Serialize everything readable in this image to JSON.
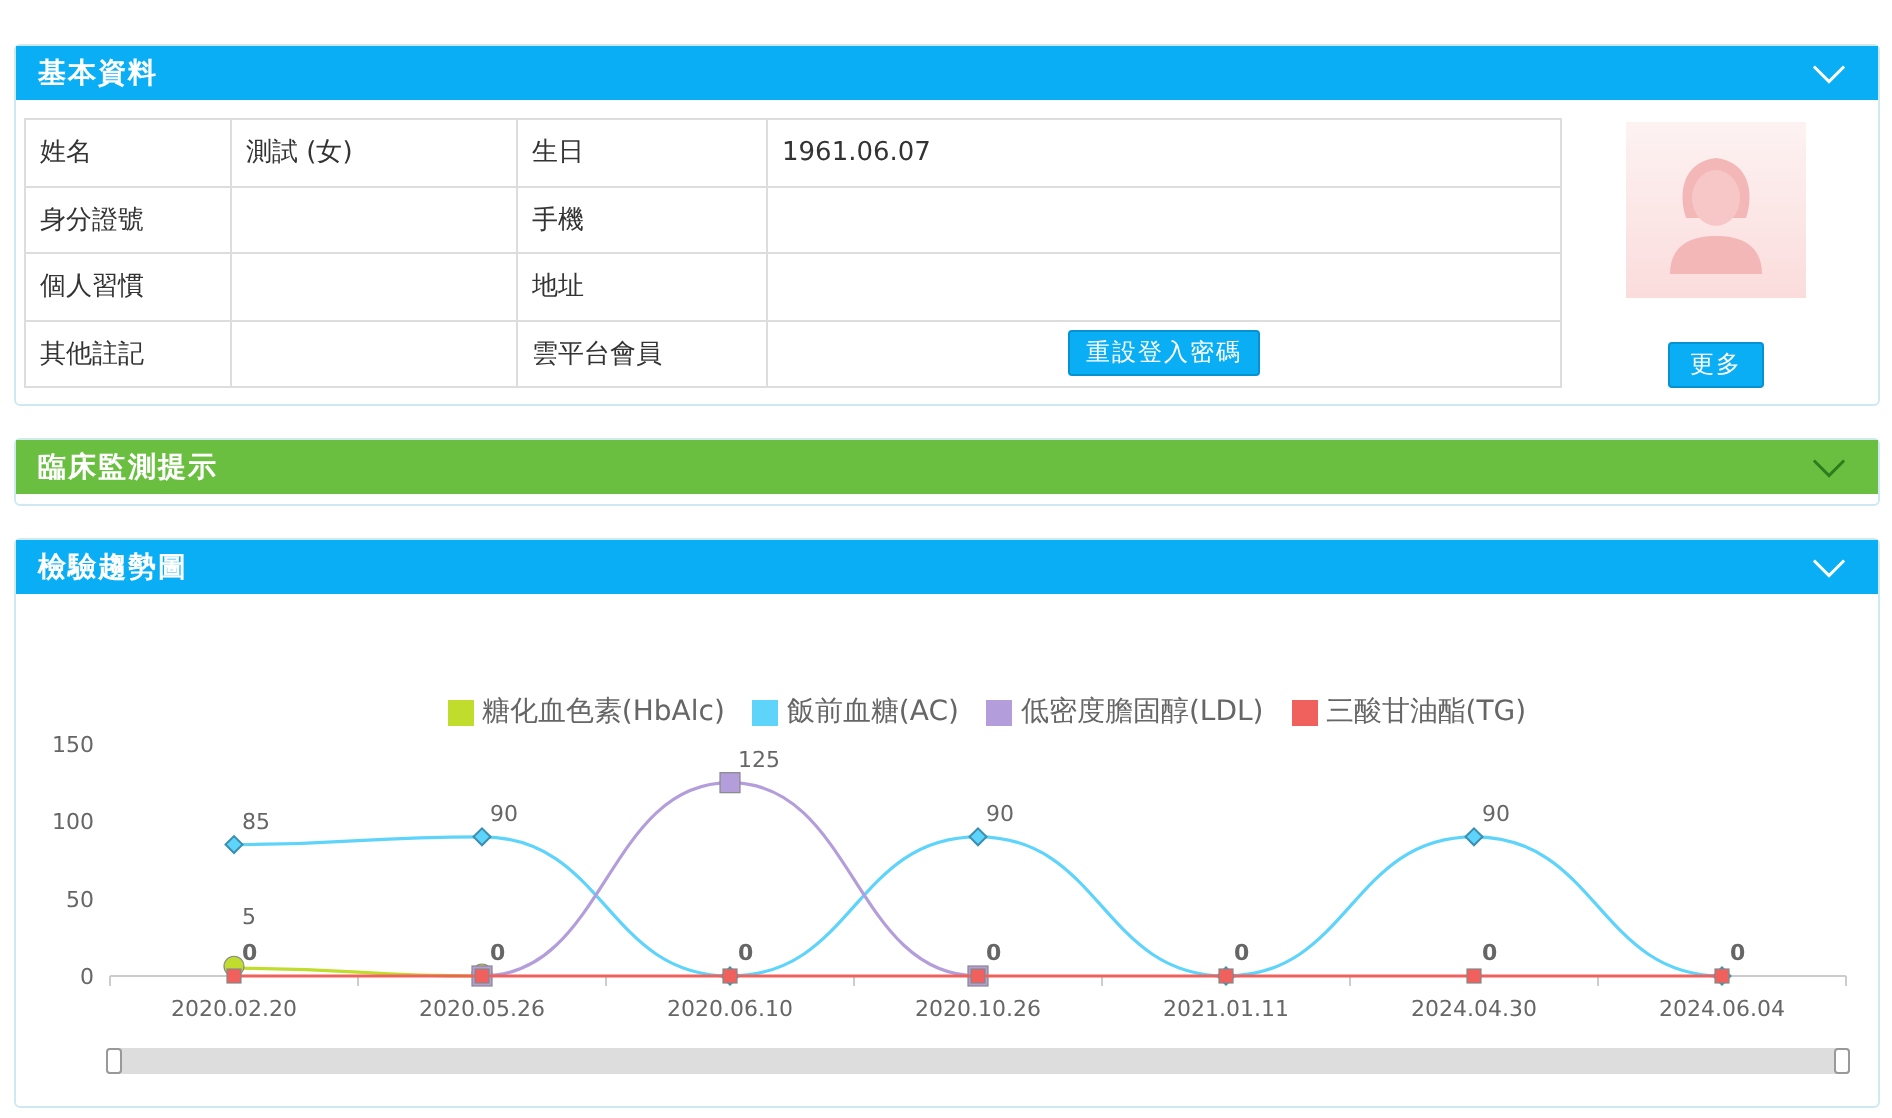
{
  "panels": [
    {
      "title": "基本資料",
      "color": "#0aaef5",
      "expanded": true,
      "kind": "profile"
    },
    {
      "title": "臨床監測提示",
      "color": "#6abf40",
      "expanded": false,
      "kind": "empty"
    },
    {
      "title": "檢驗趨勢圖",
      "color": "#0aaef5",
      "expanded": true,
      "kind": "chart"
    }
  ],
  "profile": {
    "rows": [
      [
        {
          "kind": "text",
          "text": "姓名"
        },
        {
          "kind": "text",
          "text": "測試 (女)"
        },
        {
          "kind": "text",
          "text": "生日"
        },
        {
          "kind": "text",
          "text": "1961.06.07"
        }
      ],
      [
        {
          "kind": "text",
          "text": "身分證號"
        },
        {
          "kind": "text",
          "text": ""
        },
        {
          "kind": "text",
          "text": "手機"
        },
        {
          "kind": "text",
          "text": ""
        }
      ],
      [
        {
          "kind": "text",
          "text": "個人習慣"
        },
        {
          "kind": "text",
          "text": ""
        },
        {
          "kind": "text",
          "text": "地址"
        },
        {
          "kind": "text",
          "text": ""
        }
      ],
      [
        {
          "kind": "text",
          "text": "其他註記"
        },
        {
          "kind": "text",
          "text": ""
        },
        {
          "kind": "text",
          "text": "雲平台會員"
        },
        {
          "kind": "button",
          "text": "重設登入密碼"
        }
      ]
    ],
    "more_button": "更多"
  },
  "chart_data": {
    "type": "line",
    "categories": [
      "2020.02.20",
      "2020.05.26",
      "2020.06.10",
      "2020.10.26",
      "2021.01.11",
      "2024.04.30",
      "2024.06.04"
    ],
    "series": [
      {
        "name": "糖化血色素(HbAlc)",
        "color": "#c0dd2d",
        "marker": "circle",
        "values": [
          5,
          0,
          null,
          null,
          null,
          null,
          null
        ]
      },
      {
        "name": "飯前血糖(AC)",
        "color": "#5ed4fb",
        "marker": "diamond",
        "values": [
          85,
          90,
          0,
          90,
          0,
          90,
          0
        ]
      },
      {
        "name": "低密度膽固醇(LDL)",
        "color": "#b39ddb",
        "marker": "square",
        "values": [
          null,
          0,
          125,
          0,
          null,
          null,
          null
        ]
      },
      {
        "name": "三酸甘油酯(TG)",
        "color": "#f0605d",
        "marker": "square",
        "values": [
          0,
          0,
          0,
          0,
          0,
          0,
          0
        ]
      }
    ],
    "legend": true,
    "ylim": [
      0,
      150
    ],
    "yticks": [
      0,
      50,
      100,
      150
    ],
    "value_labels": [
      [
        "5",
        null,
        null,
        null,
        null,
        null,
        null
      ],
      [
        "85",
        "90",
        null,
        "90",
        null,
        "90",
        null
      ],
      [
        null,
        null,
        "125",
        null,
        null,
        null,
        null
      ],
      [
        "0",
        "0",
        "0",
        "0",
        "0",
        "0",
        "0"
      ]
    ]
  }
}
